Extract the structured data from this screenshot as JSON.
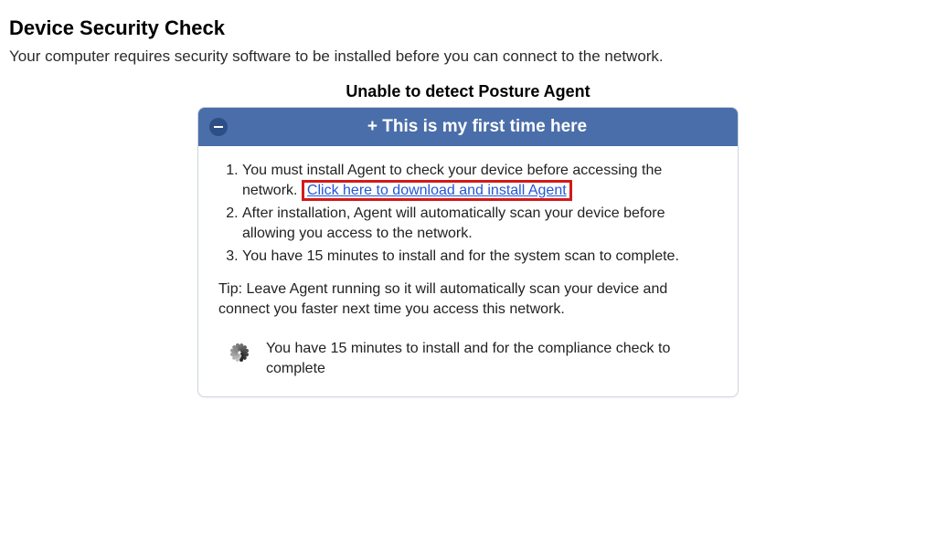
{
  "page": {
    "title": "Device Security Check",
    "subtitle": "Your computer requires security software to be installed before you can connect to the network."
  },
  "detect_message": "Unable to detect Posture Agent",
  "panel": {
    "header_title": "+ This is my first time here",
    "collapse_icon_name": "minus-icon",
    "steps": {
      "s1_prefix": "You must install Agent to check your device before accessing the network. ",
      "s1_link": "Click here to download and install Agent",
      "s2": "After installation, Agent will automatically scan your device before allowing you access to the network.",
      "s3": "You have 15 minutes to install and for the system scan to complete."
    },
    "tip": "Tip: Leave Agent running so it will automatically scan your device and connect you faster next time you access this network.",
    "status_text": "You have 15 minutes to install and for the compliance check to complete"
  },
  "colors": {
    "panel_header_bg": "#4a6ea9",
    "link": "#2257d6",
    "highlight_border": "#d21a1a"
  }
}
